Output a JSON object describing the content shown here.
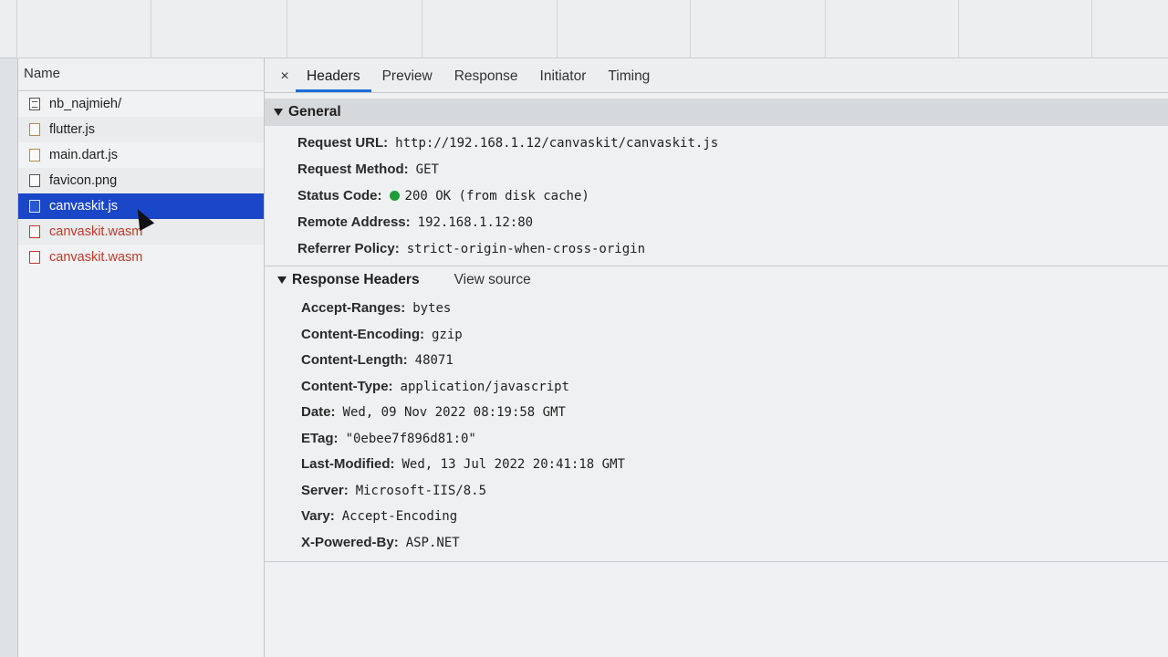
{
  "request_list": {
    "header": "Name",
    "items": [
      {
        "name": "nb_najmieh/",
        "icon": "document-icon",
        "status": "ok"
      },
      {
        "name": "flutter.js",
        "icon": "script-file-icon",
        "status": "ok"
      },
      {
        "name": "main.dart.js",
        "icon": "script-file-icon",
        "status": "ok"
      },
      {
        "name": "favicon.png",
        "icon": "image-file-icon",
        "status": "ok"
      },
      {
        "name": "canvaskit.js",
        "icon": "script-file-icon",
        "status": "selected"
      },
      {
        "name": "canvaskit.wasm",
        "icon": "file-icon",
        "status": "failed"
      },
      {
        "name": "canvaskit.wasm",
        "icon": "file-icon",
        "status": "failed"
      }
    ]
  },
  "tabs": {
    "close": "×",
    "items": [
      "Headers",
      "Preview",
      "Response",
      "Initiator",
      "Timing"
    ],
    "active": "Headers"
  },
  "general": {
    "title": "General",
    "fields": [
      {
        "key": "Request URL:",
        "value": "http://192.168.1.12/canvaskit/canvaskit.js"
      },
      {
        "key": "Request Method:",
        "value": "GET"
      },
      {
        "key": "Status Code:",
        "value": "200 OK (from disk cache)"
      },
      {
        "key": "Remote Address:",
        "value": "192.168.1.12:80"
      },
      {
        "key": "Referrer Policy:",
        "value": "strict-origin-when-cross-origin"
      }
    ],
    "status_color": "#1e9e36"
  },
  "response_headers": {
    "title": "Response Headers",
    "view_source": "View source",
    "fields": [
      {
        "key": "Accept-Ranges:",
        "value": "bytes"
      },
      {
        "key": "Content-Encoding:",
        "value": "gzip"
      },
      {
        "key": "Content-Length:",
        "value": "48071"
      },
      {
        "key": "Content-Type:",
        "value": "application/javascript"
      },
      {
        "key": "Date:",
        "value": "Wed, 09 Nov 2022 08:19:58 GMT"
      },
      {
        "key": "ETag:",
        "value": "\"0ebee7f896d81:0\""
      },
      {
        "key": "Last-Modified:",
        "value": "Wed, 13 Jul 2022 20:41:18 GMT"
      },
      {
        "key": "Server:",
        "value": "Microsoft-IIS/8.5"
      },
      {
        "key": "Vary:",
        "value": "Accept-Encoding"
      },
      {
        "key": "X-Powered-By:",
        "value": "ASP.NET"
      }
    ]
  },
  "colors": {
    "selected_row": "#1a47c8",
    "failed_text": "#c0392b",
    "active_tab_underline": "#1a6fd8"
  }
}
